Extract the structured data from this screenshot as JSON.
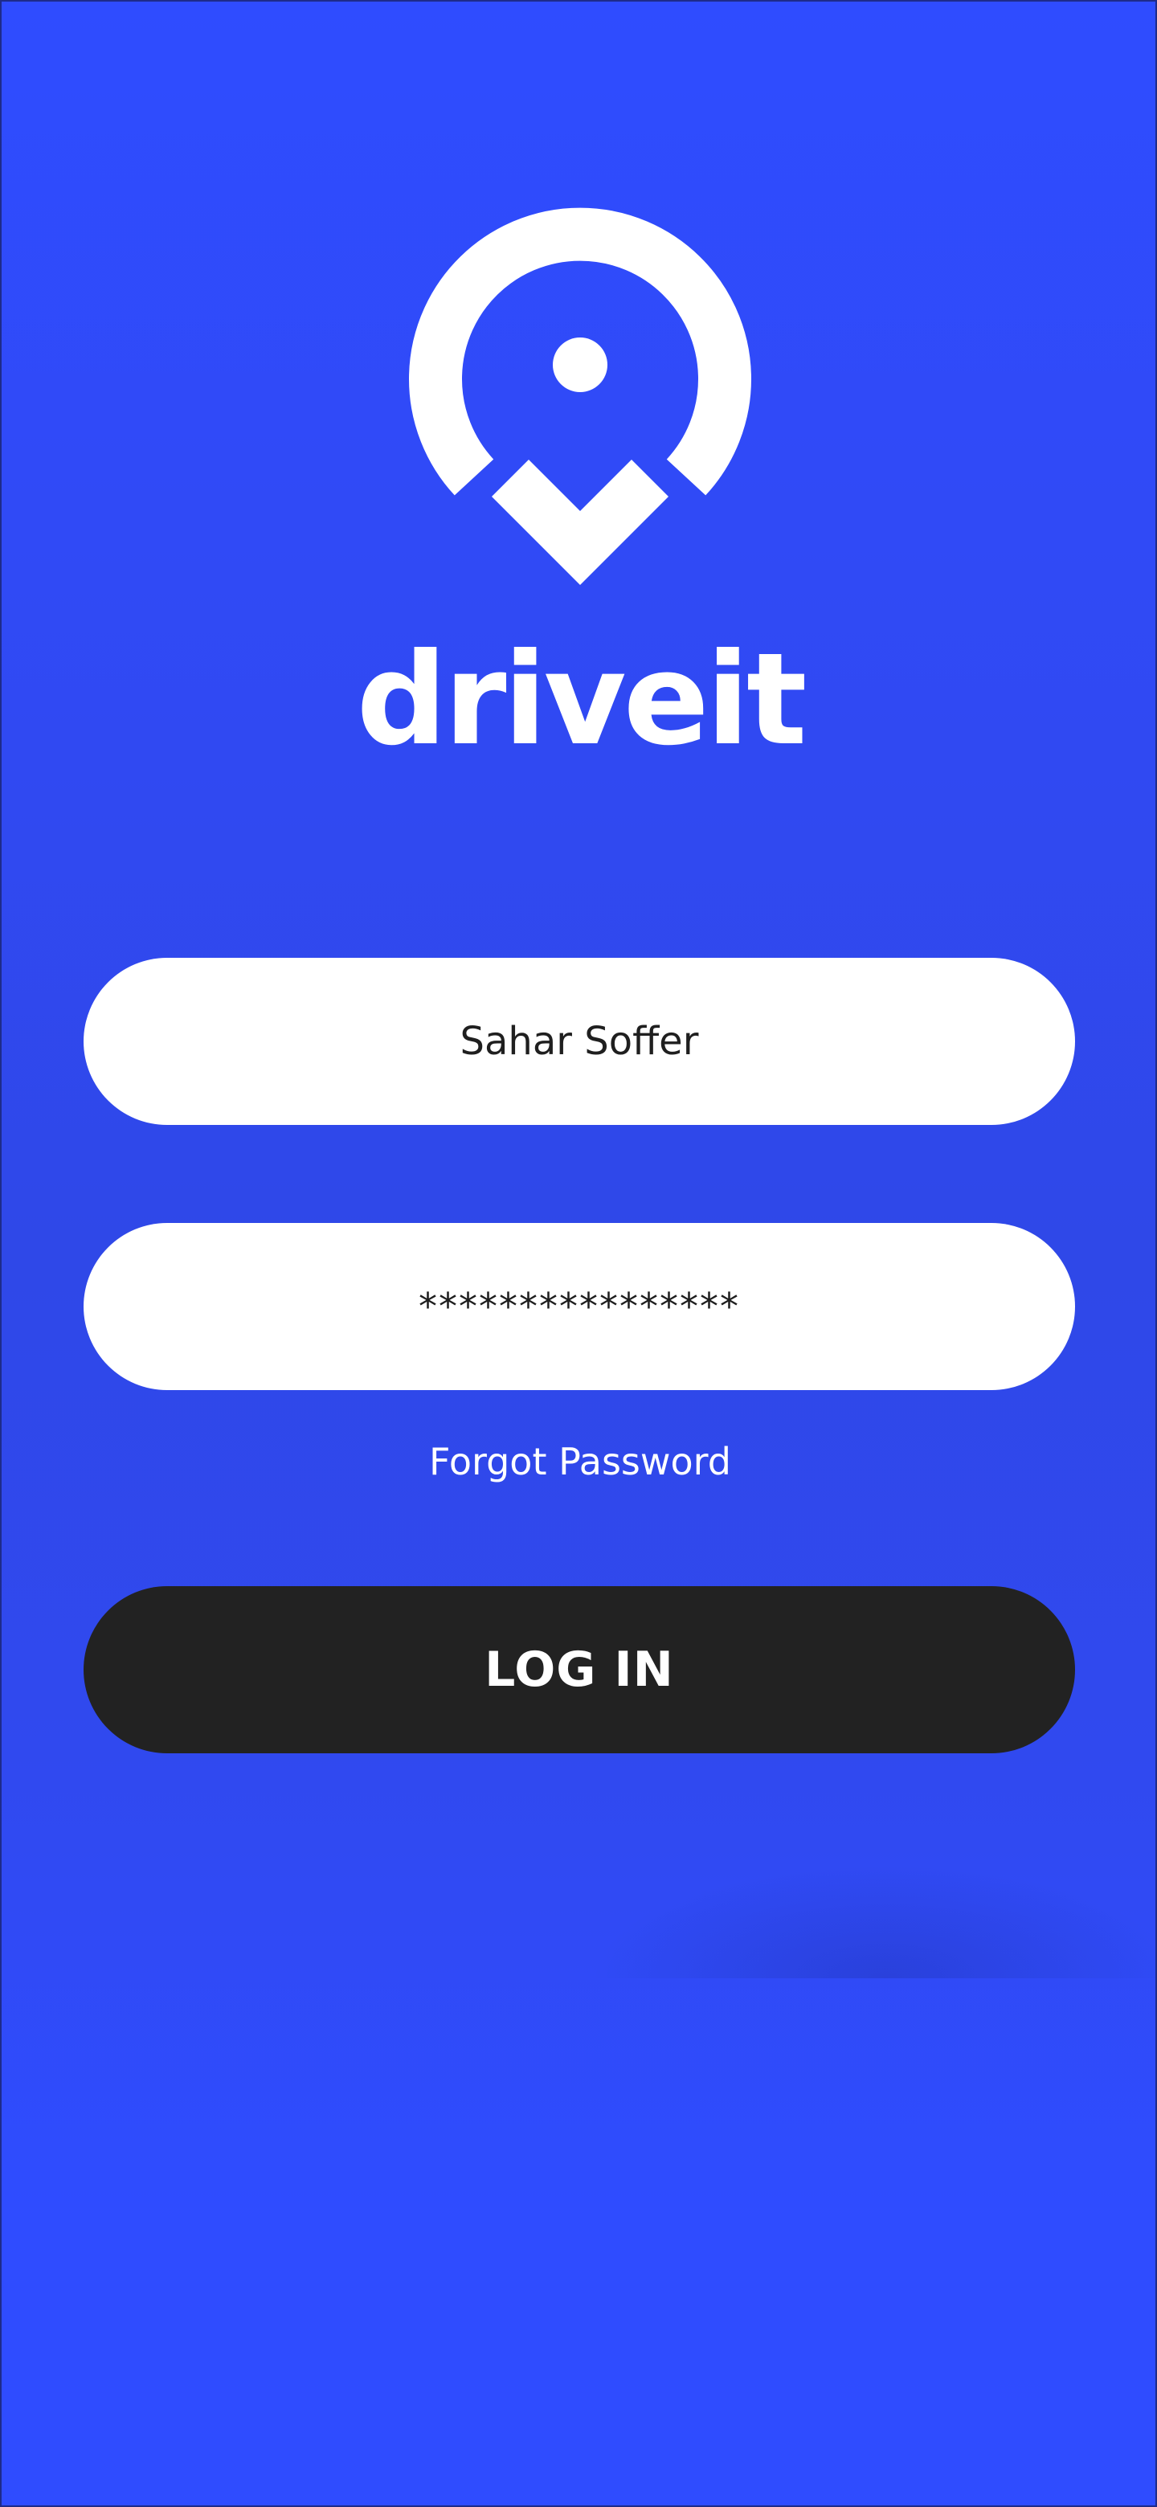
{
  "brand": {
    "name": "driveit",
    "logo_icon": "location-pin-icon"
  },
  "form": {
    "username_value": "Sahar Soffer",
    "password_value": "****************",
    "forgot_label": "Forgot Password",
    "login_label": "LOG IN"
  },
  "colors": {
    "background": "#2f4cff",
    "field": "#ffffff",
    "button": "#222222",
    "text_dark": "#1f1f1f",
    "text_light": "#ffffff"
  }
}
